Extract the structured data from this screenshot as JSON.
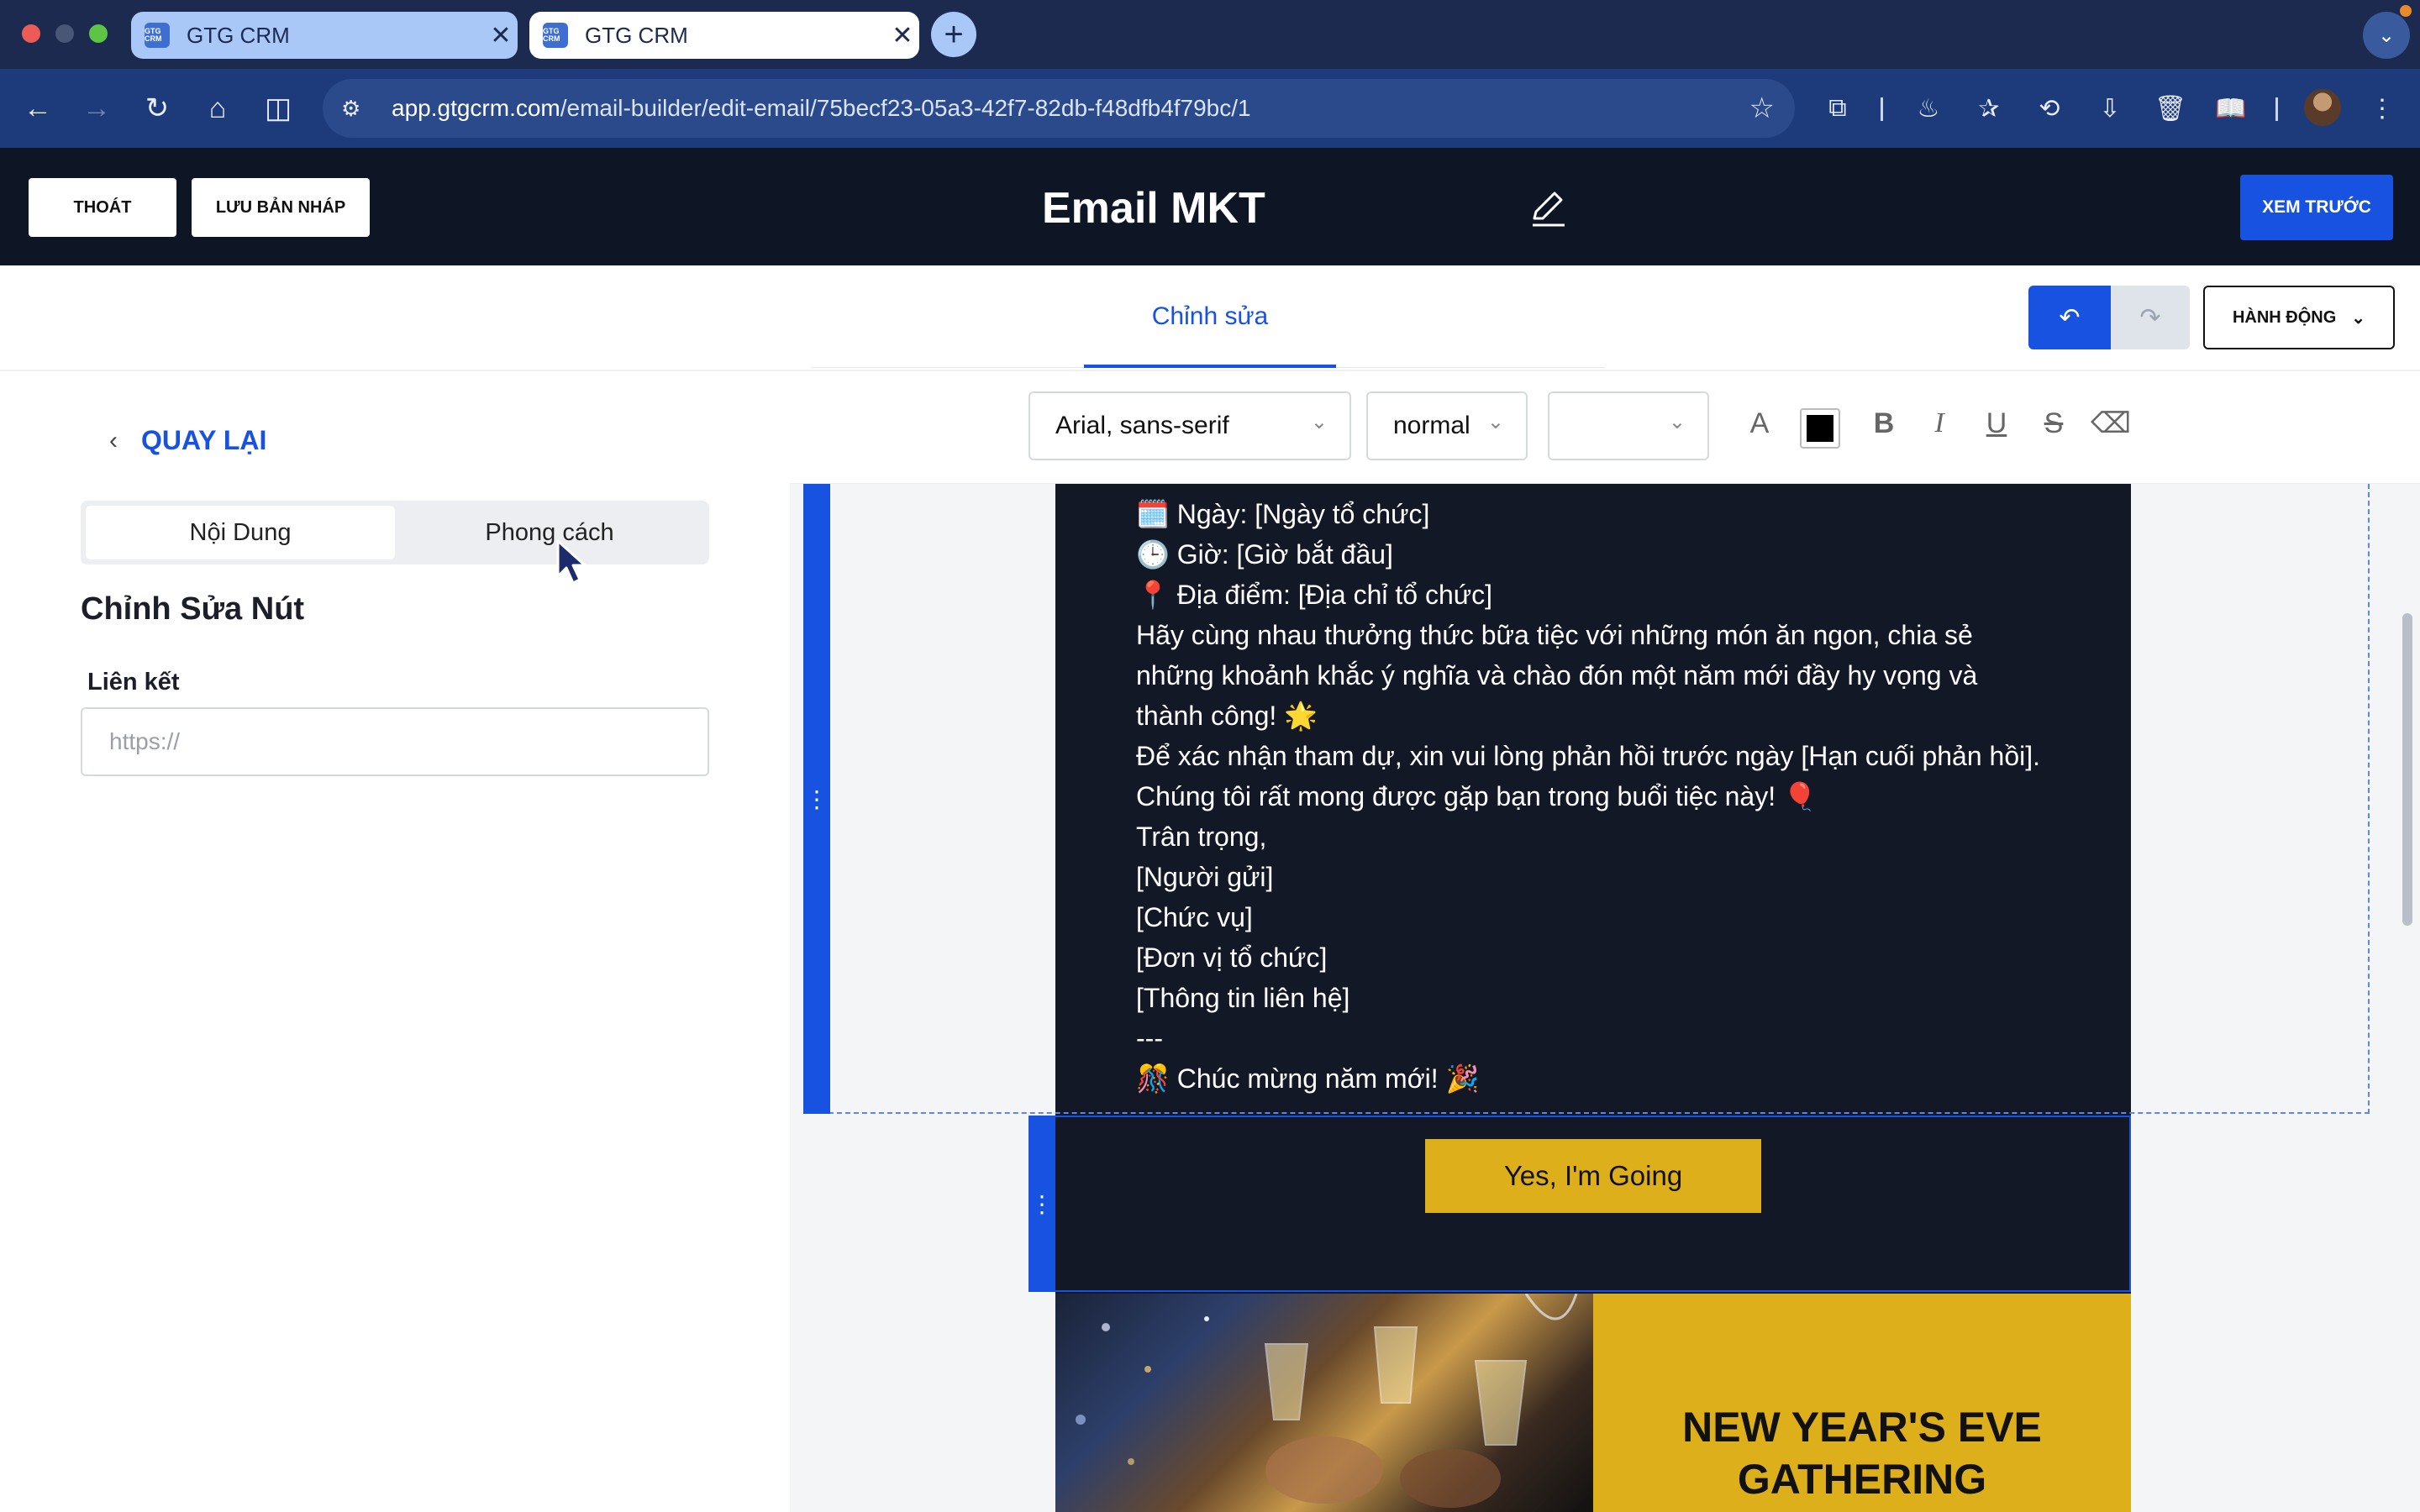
{
  "browser": {
    "tabs": [
      {
        "title": "GTG CRM",
        "favicon_text": "GTG CRM",
        "close": "✕"
      },
      {
        "title": "GTG CRM",
        "favicon_text": "GTG CRM",
        "close": "✕"
      }
    ],
    "new_tab": "+",
    "url_host": "app.gtgcrm.com",
    "url_path": "/email-builder/edit-email/75becf23-05a3-42f7-82db-f48dfb4f79bc/1"
  },
  "header": {
    "exit_label": "THOÁT",
    "save_draft_label": "LƯU BẢN NHÁP",
    "title": "Email MKT",
    "preview_label": "XEM TRƯỚC"
  },
  "editor": {
    "tab_label": "Chỉnh sửa",
    "actions_label": "HÀNH ĐỘNG"
  },
  "panel": {
    "back_label": "QUAY LẠI",
    "segments": [
      "Nội Dung",
      "Phong cách"
    ],
    "active_segment": "Nội Dung",
    "section_title": "Chỉnh Sửa Nút",
    "link_label": "Liên kết",
    "link_placeholder": "https://",
    "link_value": ""
  },
  "format": {
    "font_family": "Arial, sans-serif",
    "font_weight": "normal",
    "font_size": "",
    "text_color": "#000000"
  },
  "email": {
    "lines": [
      "🗓️ Ngày: [Ngày tổ chức]",
      "🕒 Giờ: [Giờ bắt đầu]",
      "📍 Địa điểm: [Địa chỉ tổ chức]",
      "Hãy cùng nhau thưởng thức bữa tiệc với những món ăn ngon, chia sẻ",
      "những khoảnh khắc ý nghĩa và chào đón một năm mới đầy hy vọng và",
      "thành công! 🌟",
      "Để xác nhận tham dự, xin vui lòng phản hồi trước ngày [Hạn cuối phản hồi].",
      "Chúng tôi rất mong được gặp bạn trong buổi tiệc này! 🎈",
      "Trân trọng,",
      "[Người gửi]",
      "[Chức vụ]",
      "[Đơn vị tổ chức]",
      "[Thông tin liên hệ]",
      "---",
      "🎊 Chúc mừng năm mới! 🎉"
    ],
    "cta_label": "Yes, I'm Going",
    "banner_title": "NEW YEAR'S EVE GATHERING"
  },
  "colors": {
    "accent_blue": "#1852e0",
    "header_dark": "#0e1625",
    "email_dark": "#121826",
    "cta_gold": "#ddaf1b"
  }
}
